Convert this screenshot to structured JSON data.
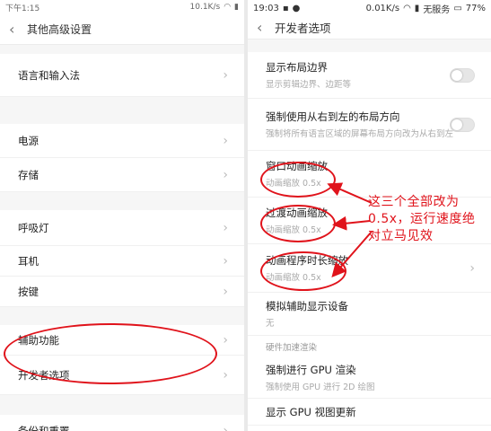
{
  "left": {
    "status": {
      "time": "下午1:15",
      "speed": "10.1K/s"
    },
    "title": "其他高级设置",
    "rows": [
      {
        "label": "语言和输入法"
      },
      {
        "label": "电源"
      },
      {
        "label": "存储"
      },
      {
        "label": "呼吸灯"
      },
      {
        "label": "耳机"
      },
      {
        "label": "按键"
      },
      {
        "label": "辅助功能"
      },
      {
        "label": "开发者选项"
      },
      {
        "label": "备份和重置"
      }
    ]
  },
  "right": {
    "status": {
      "time": "19:03",
      "speed": "0.01K/s",
      "carrier": "无服务",
      "battery": "77%"
    },
    "title": "开发者选项",
    "rows": [
      {
        "label": "显示布局边界",
        "sub": "显示剪辑边界、边距等"
      },
      {
        "label": "强制使用从右到左的布局方向",
        "sub": "强制将所有语言区域的屏幕布局方向改为从右到左"
      },
      {
        "label": "窗口动画缩放",
        "sub": "动画缩放 0.5x"
      },
      {
        "label": "过渡动画缩放",
        "sub": "动画缩放 0.5x"
      },
      {
        "label": "动画程序时长缩放",
        "sub": "动画缩放 0.5x"
      },
      {
        "label": "模拟辅助显示设备",
        "sub": "无"
      },
      {
        "label": "强制进行 GPU 渲染",
        "sub": "强制使用 GPU 进行 2D 绘图"
      },
      {
        "label": "显示 GPU 视图更新"
      }
    ],
    "section_hardware": "硬件加速渲染"
  },
  "annotation": {
    "line1": "这三个全部改为",
    "line2": "0.5x，运行速度绝",
    "line3": "对立马见效"
  },
  "colors": {
    "annotation": "#e0131b"
  }
}
